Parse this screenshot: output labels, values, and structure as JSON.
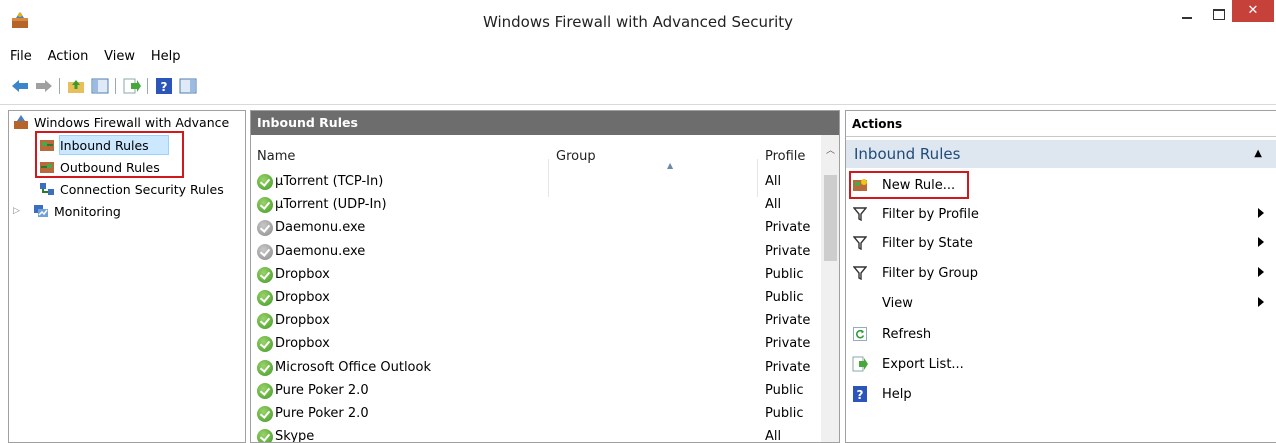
{
  "window": {
    "title": "Windows Firewall with Advanced Security",
    "close_glyph": "✕"
  },
  "menu": [
    "File",
    "Action",
    "View",
    "Help"
  ],
  "tree": {
    "root": "Windows Firewall with Advance",
    "inbound": "Inbound Rules",
    "outbound": "Outbound Rules",
    "connection_security": "Connection Security Rules",
    "monitoring": "Monitoring"
  },
  "center": {
    "header": "Inbound Rules",
    "columns": {
      "name": "Name",
      "group": "Group",
      "profile": "Profile"
    },
    "rows": [
      {
        "name": "µTorrent (TCP-In)",
        "profile": "All",
        "enabled": true
      },
      {
        "name": "µTorrent (UDP-In)",
        "profile": "All",
        "enabled": true
      },
      {
        "name": "Daemonu.exe",
        "profile": "Private",
        "enabled": false
      },
      {
        "name": "Daemonu.exe",
        "profile": "Private",
        "enabled": false
      },
      {
        "name": "Dropbox",
        "profile": "Public",
        "enabled": true
      },
      {
        "name": "Dropbox",
        "profile": "Public",
        "enabled": true
      },
      {
        "name": "Dropbox",
        "profile": "Private",
        "enabled": true
      },
      {
        "name": "Dropbox",
        "profile": "Private",
        "enabled": true
      },
      {
        "name": "Microsoft Office Outlook",
        "profile": "Private",
        "enabled": true
      },
      {
        "name": "Pure Poker 2.0",
        "profile": "Public",
        "enabled": true
      },
      {
        "name": "Pure Poker 2.0",
        "profile": "Public",
        "enabled": true
      },
      {
        "name": "Skype",
        "profile": "All",
        "enabled": true
      }
    ]
  },
  "actions": {
    "header": "Actions",
    "section": "Inbound Rules",
    "new_rule": "New Rule...",
    "filter_profile": "Filter by Profile",
    "filter_state": "Filter by State",
    "filter_group": "Filter by Group",
    "view": "View",
    "refresh": "Refresh",
    "export": "Export List...",
    "help": "Help"
  },
  "colors": {
    "highlight": "#d0191c",
    "section_bg": "#dee7ef",
    "pane_header": "#6d6d6d"
  }
}
